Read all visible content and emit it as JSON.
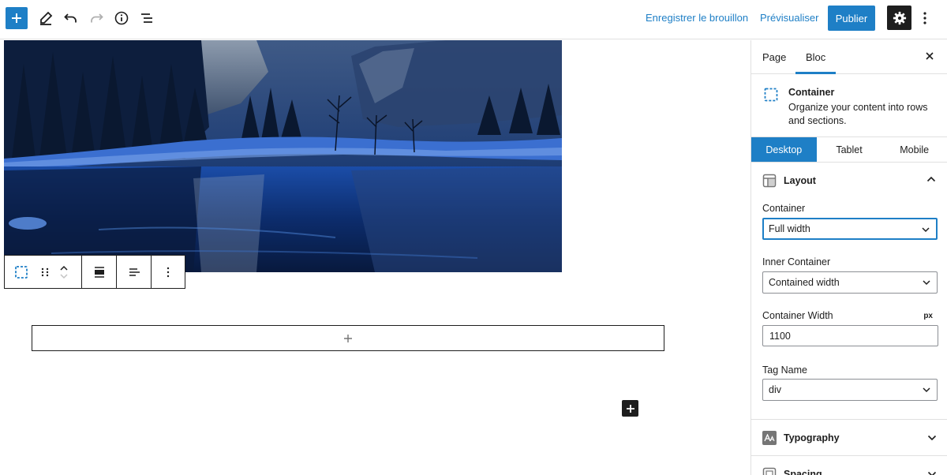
{
  "toolbar": {
    "draft_label": "Enregistrer le brouillon",
    "preview_label": "Prévisualiser",
    "publish_label": "Publier"
  },
  "sidebar": {
    "tabs": [
      "Page",
      "Bloc"
    ],
    "block": {
      "title": "Container",
      "description": "Organize your content into rows and sections."
    },
    "devices": [
      "Desktop",
      "Tablet",
      "Mobile"
    ],
    "layout": {
      "title": "Layout",
      "container_label": "Container",
      "container_value": "Full width",
      "inner_label": "Inner Container",
      "inner_value": "Contained width",
      "width_label": "Container Width",
      "width_unit": "px",
      "width_value": "1100",
      "tag_label": "Tag Name",
      "tag_value": "div"
    },
    "typography_title": "Typography",
    "spacing_title": "Spacing"
  },
  "colors": {
    "accent": "#1e7fc6",
    "dark": "#1e1e1e"
  }
}
